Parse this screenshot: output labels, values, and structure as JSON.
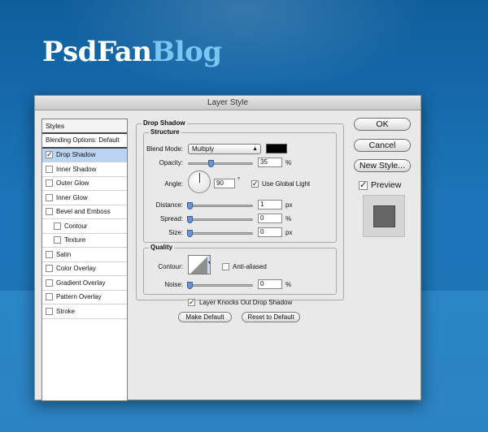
{
  "logo": {
    "part1": "PsdFan",
    "part2": "Blog"
  },
  "window": {
    "title": "Layer Style",
    "styles_header": "Styles",
    "style_items": [
      {
        "label": "Blending Options: Default",
        "checkbox": false,
        "checked": false,
        "selected": false
      },
      {
        "label": "Drop Shadow",
        "checkbox": true,
        "checked": true,
        "selected": true
      },
      {
        "label": "Inner Shadow",
        "checkbox": true,
        "checked": false,
        "selected": false
      },
      {
        "label": "Outer Glow",
        "checkbox": true,
        "checked": false,
        "selected": false
      },
      {
        "label": "Inner Glow",
        "checkbox": true,
        "checked": false,
        "selected": false
      },
      {
        "label": "Bevel and Emboss",
        "checkbox": true,
        "checked": false,
        "selected": false
      },
      {
        "label": "Contour",
        "checkbox": true,
        "checked": false,
        "selected": false,
        "indent": true
      },
      {
        "label": "Texture",
        "checkbox": true,
        "checked": false,
        "selected": false,
        "indent": true
      },
      {
        "label": "Satin",
        "checkbox": true,
        "checked": false,
        "selected": false
      },
      {
        "label": "Color Overlay",
        "checkbox": true,
        "checked": false,
        "selected": false
      },
      {
        "label": "Gradient Overlay",
        "checkbox": true,
        "checked": false,
        "selected": false
      },
      {
        "label": "Pattern Overlay",
        "checkbox": true,
        "checked": false,
        "selected": false
      },
      {
        "label": "Stroke",
        "checkbox": true,
        "checked": false,
        "selected": false
      }
    ],
    "drop_shadow": {
      "title": "Drop Shadow",
      "structure_title": "Structure",
      "blend_mode_label": "Blend Mode:",
      "blend_mode_value": "Multiply",
      "shadow_color": "#000000",
      "opacity_label": "Opacity:",
      "opacity_value": "35",
      "opacity_level": 35,
      "opacity_unit": "%",
      "angle_label": "Angle:",
      "angle_value": "90",
      "angle_unit": "°",
      "use_global_light_label": "Use Global Light",
      "use_global_light_checked": true,
      "distance_label": "Distance:",
      "distance_value": "1",
      "distance_unit": "px",
      "spread_label": "Spread:",
      "spread_value": "0",
      "spread_unit": "%",
      "size_label": "Size:",
      "size_value": "0",
      "size_unit": "px",
      "quality_title": "Quality",
      "contour_label": "Contour:",
      "anti_aliased_label": "Anti-aliased",
      "anti_aliased_checked": false,
      "noise_label": "Noise:",
      "noise_value": "0",
      "noise_unit": "%",
      "knockout_label": "Layer Knocks Out Drop Shadow",
      "knockout_checked": true,
      "make_default_label": "Make Default",
      "reset_default_label": "Reset to Default"
    },
    "buttons": {
      "ok": "OK",
      "cancel": "Cancel",
      "new_style": "New Style...",
      "preview_label": "Preview",
      "preview_checked": true
    },
    "colors": {
      "selection": "#b9d5f3",
      "preview_swatch": "#666666"
    }
  }
}
